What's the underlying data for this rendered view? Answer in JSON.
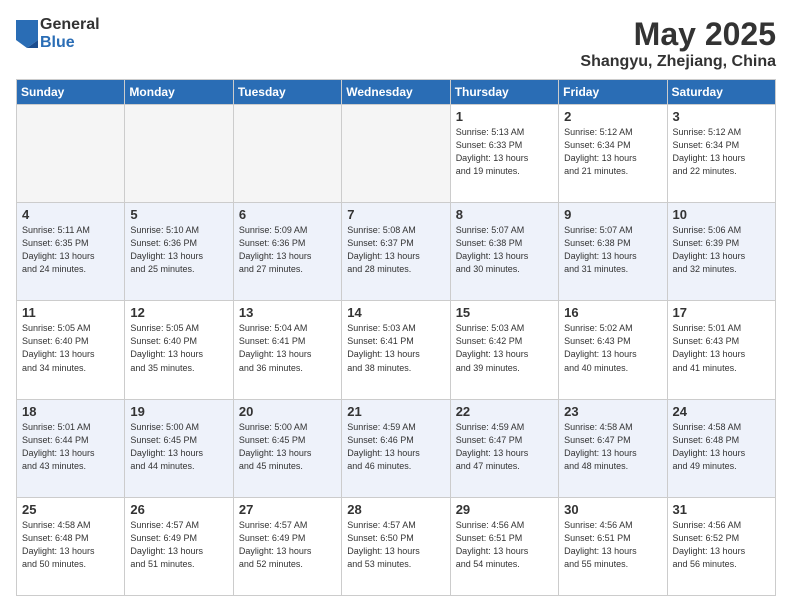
{
  "logo": {
    "general": "General",
    "blue": "Blue"
  },
  "title": {
    "month": "May 2025",
    "location": "Shangyu, Zhejiang, China"
  },
  "days_header": [
    "Sunday",
    "Monday",
    "Tuesday",
    "Wednesday",
    "Thursday",
    "Friday",
    "Saturday"
  ],
  "weeks": [
    [
      {
        "day": "",
        "info": "",
        "empty": true
      },
      {
        "day": "",
        "info": "",
        "empty": true
      },
      {
        "day": "",
        "info": "",
        "empty": true
      },
      {
        "day": "",
        "info": "",
        "empty": true
      },
      {
        "day": "1",
        "info": "Sunrise: 5:13 AM\nSunset: 6:33 PM\nDaylight: 13 hours\nand 19 minutes.",
        "empty": false
      },
      {
        "day": "2",
        "info": "Sunrise: 5:12 AM\nSunset: 6:34 PM\nDaylight: 13 hours\nand 21 minutes.",
        "empty": false
      },
      {
        "day": "3",
        "info": "Sunrise: 5:12 AM\nSunset: 6:34 PM\nDaylight: 13 hours\nand 22 minutes.",
        "empty": false
      }
    ],
    [
      {
        "day": "4",
        "info": "Sunrise: 5:11 AM\nSunset: 6:35 PM\nDaylight: 13 hours\nand 24 minutes.",
        "empty": false
      },
      {
        "day": "5",
        "info": "Sunrise: 5:10 AM\nSunset: 6:36 PM\nDaylight: 13 hours\nand 25 minutes.",
        "empty": false
      },
      {
        "day": "6",
        "info": "Sunrise: 5:09 AM\nSunset: 6:36 PM\nDaylight: 13 hours\nand 27 minutes.",
        "empty": false
      },
      {
        "day": "7",
        "info": "Sunrise: 5:08 AM\nSunset: 6:37 PM\nDaylight: 13 hours\nand 28 minutes.",
        "empty": false
      },
      {
        "day": "8",
        "info": "Sunrise: 5:07 AM\nSunset: 6:38 PM\nDaylight: 13 hours\nand 30 minutes.",
        "empty": false
      },
      {
        "day": "9",
        "info": "Sunrise: 5:07 AM\nSunset: 6:38 PM\nDaylight: 13 hours\nand 31 minutes.",
        "empty": false
      },
      {
        "day": "10",
        "info": "Sunrise: 5:06 AM\nSunset: 6:39 PM\nDaylight: 13 hours\nand 32 minutes.",
        "empty": false
      }
    ],
    [
      {
        "day": "11",
        "info": "Sunrise: 5:05 AM\nSunset: 6:40 PM\nDaylight: 13 hours\nand 34 minutes.",
        "empty": false
      },
      {
        "day": "12",
        "info": "Sunrise: 5:05 AM\nSunset: 6:40 PM\nDaylight: 13 hours\nand 35 minutes.",
        "empty": false
      },
      {
        "day": "13",
        "info": "Sunrise: 5:04 AM\nSunset: 6:41 PM\nDaylight: 13 hours\nand 36 minutes.",
        "empty": false
      },
      {
        "day": "14",
        "info": "Sunrise: 5:03 AM\nSunset: 6:41 PM\nDaylight: 13 hours\nand 38 minutes.",
        "empty": false
      },
      {
        "day": "15",
        "info": "Sunrise: 5:03 AM\nSunset: 6:42 PM\nDaylight: 13 hours\nand 39 minutes.",
        "empty": false
      },
      {
        "day": "16",
        "info": "Sunrise: 5:02 AM\nSunset: 6:43 PM\nDaylight: 13 hours\nand 40 minutes.",
        "empty": false
      },
      {
        "day": "17",
        "info": "Sunrise: 5:01 AM\nSunset: 6:43 PM\nDaylight: 13 hours\nand 41 minutes.",
        "empty": false
      }
    ],
    [
      {
        "day": "18",
        "info": "Sunrise: 5:01 AM\nSunset: 6:44 PM\nDaylight: 13 hours\nand 43 minutes.",
        "empty": false
      },
      {
        "day": "19",
        "info": "Sunrise: 5:00 AM\nSunset: 6:45 PM\nDaylight: 13 hours\nand 44 minutes.",
        "empty": false
      },
      {
        "day": "20",
        "info": "Sunrise: 5:00 AM\nSunset: 6:45 PM\nDaylight: 13 hours\nand 45 minutes.",
        "empty": false
      },
      {
        "day": "21",
        "info": "Sunrise: 4:59 AM\nSunset: 6:46 PM\nDaylight: 13 hours\nand 46 minutes.",
        "empty": false
      },
      {
        "day": "22",
        "info": "Sunrise: 4:59 AM\nSunset: 6:47 PM\nDaylight: 13 hours\nand 47 minutes.",
        "empty": false
      },
      {
        "day": "23",
        "info": "Sunrise: 4:58 AM\nSunset: 6:47 PM\nDaylight: 13 hours\nand 48 minutes.",
        "empty": false
      },
      {
        "day": "24",
        "info": "Sunrise: 4:58 AM\nSunset: 6:48 PM\nDaylight: 13 hours\nand 49 minutes.",
        "empty": false
      }
    ],
    [
      {
        "day": "25",
        "info": "Sunrise: 4:58 AM\nSunset: 6:48 PM\nDaylight: 13 hours\nand 50 minutes.",
        "empty": false
      },
      {
        "day": "26",
        "info": "Sunrise: 4:57 AM\nSunset: 6:49 PM\nDaylight: 13 hours\nand 51 minutes.",
        "empty": false
      },
      {
        "day": "27",
        "info": "Sunrise: 4:57 AM\nSunset: 6:49 PM\nDaylight: 13 hours\nand 52 minutes.",
        "empty": false
      },
      {
        "day": "28",
        "info": "Sunrise: 4:57 AM\nSunset: 6:50 PM\nDaylight: 13 hours\nand 53 minutes.",
        "empty": false
      },
      {
        "day": "29",
        "info": "Sunrise: 4:56 AM\nSunset: 6:51 PM\nDaylight: 13 hours\nand 54 minutes.",
        "empty": false
      },
      {
        "day": "30",
        "info": "Sunrise: 4:56 AM\nSunset: 6:51 PM\nDaylight: 13 hours\nand 55 minutes.",
        "empty": false
      },
      {
        "day": "31",
        "info": "Sunrise: 4:56 AM\nSunset: 6:52 PM\nDaylight: 13 hours\nand 56 minutes.",
        "empty": false
      }
    ]
  ]
}
